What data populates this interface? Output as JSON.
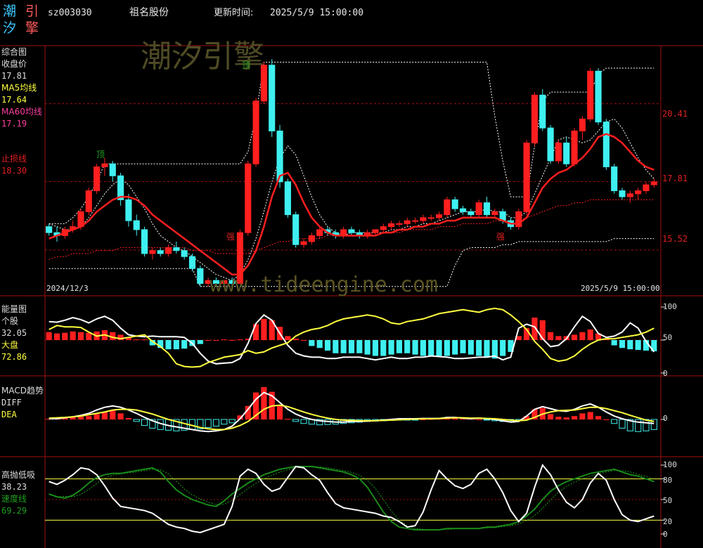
{
  "header": {
    "logo_chars": [
      "潮",
      "引",
      "汐",
      "擎"
    ],
    "code": "sz003030",
    "name": "祖名股份",
    "update_label": "更新时间:",
    "update_time": "2025/5/9 15:00:00"
  },
  "watermark": {
    "main": "潮汐引擎",
    "url": "www.tideengine.com"
  },
  "colors": {
    "up": "#ff1f1f",
    "down": "#3ff0f0",
    "ma5": "#ffff40",
    "ma60": "#ff3fa0",
    "grid": "#a01010",
    "stop": "#e02020",
    "green": "#1a8a1a"
  },
  "panels": {
    "main": {
      "title": "综合图",
      "close_label": "收盘价",
      "close_value": "17.81",
      "ma5_label": "MA5均线",
      "ma5_value": "17.64",
      "ma60_label": "MA60均线",
      "ma60_value": "17.19",
      "stop_label": "止损线",
      "stop_value": "18.30",
      "price_ticks": [
        "20.41",
        "17.81",
        "15.52"
      ],
      "date_start": "2024/12/3",
      "date_end": "2025/5/9  15:00:00",
      "markers": {
        "top1": "顶",
        "top2": "顶",
        "strong1": "强",
        "strong2": "强"
      }
    },
    "energy": {
      "title": "能量图",
      "stock_label": "个股",
      "stock_value": "32.05",
      "market_label": "大盘",
      "market_value": "72.86",
      "ticks": [
        "100",
        "50",
        "0"
      ]
    },
    "macd": {
      "title": "MACD趋势",
      "diff_label": "DIFF",
      "dea_label": "DEA",
      "ticks": [
        "0"
      ]
    },
    "kdj": {
      "title": "高抛低吸",
      "value1": "38.23",
      "speed_label": "速度线",
      "speed_value": "69.29",
      "ticks": [
        "100",
        "80",
        "50",
        "20",
        "0"
      ]
    }
  },
  "chart_data": {
    "type": "candlestick",
    "start_date": "2024/12/3",
    "end_date": "2025/5/9",
    "price_ylim": [
      14.2,
      22.0
    ],
    "price_ticks": [
      20.41,
      17.81,
      15.52
    ],
    "ohlc": [
      [
        16.3,
        16.4,
        16.0,
        16.1
      ],
      [
        16.1,
        16.3,
        15.8,
        16.0
      ],
      [
        16.0,
        16.3,
        15.9,
        16.2
      ],
      [
        16.2,
        16.5,
        16.1,
        16.3
      ],
      [
        16.3,
        16.9,
        16.2,
        16.8
      ],
      [
        16.8,
        17.6,
        16.7,
        17.5
      ],
      [
        17.5,
        18.4,
        17.4,
        18.3
      ],
      [
        18.3,
        18.6,
        18.0,
        18.4
      ],
      [
        18.4,
        18.5,
        17.8,
        18.0
      ],
      [
        18.0,
        18.1,
        17.0,
        17.2
      ],
      [
        17.2,
        17.4,
        16.3,
        16.5
      ],
      [
        16.5,
        16.7,
        16.0,
        16.2
      ],
      [
        16.2,
        16.3,
        15.3,
        15.4
      ],
      [
        15.4,
        15.6,
        15.2,
        15.5
      ],
      [
        15.5,
        15.6,
        15.3,
        15.4
      ],
      [
        15.4,
        15.7,
        15.3,
        15.6
      ],
      [
        15.6,
        15.8,
        15.4,
        15.5
      ],
      [
        15.5,
        15.6,
        15.2,
        15.3
      ],
      [
        15.3,
        15.4,
        14.8,
        14.9
      ],
      [
        14.9,
        15.0,
        14.3,
        14.4
      ],
      [
        14.4,
        14.6,
        14.3,
        14.5
      ],
      [
        14.5,
        14.6,
        14.3,
        14.4
      ],
      [
        14.4,
        14.5,
        14.3,
        14.5
      ],
      [
        14.5,
        14.6,
        14.3,
        14.4
      ],
      [
        14.4,
        16.2,
        14.4,
        16.1
      ],
      [
        16.1,
        18.5,
        16.0,
        18.4
      ],
      [
        18.4,
        20.6,
        18.3,
        20.5
      ],
      [
        20.5,
        21.8,
        20.4,
        21.7
      ],
      [
        21.7,
        21.9,
        19.3,
        19.5
      ],
      [
        19.5,
        19.7,
        17.6,
        17.8
      ],
      [
        17.8,
        17.9,
        16.6,
        16.7
      ],
      [
        16.7,
        16.8,
        15.6,
        15.7
      ],
      [
        15.7,
        15.9,
        15.6,
        15.8
      ],
      [
        15.8,
        16.1,
        15.7,
        16.0
      ],
      [
        16.0,
        16.3,
        15.9,
        16.2
      ],
      [
        16.2,
        16.3,
        16.0,
        16.1
      ],
      [
        16.1,
        16.2,
        15.9,
        16.0
      ],
      [
        16.0,
        16.3,
        15.9,
        16.2
      ],
      [
        16.2,
        16.3,
        16.0,
        16.1
      ],
      [
        16.1,
        16.2,
        15.9,
        16.0
      ],
      [
        16.0,
        16.2,
        15.9,
        16.1
      ],
      [
        16.1,
        16.2,
        16.0,
        16.2
      ],
      [
        16.2,
        16.4,
        16.1,
        16.3
      ],
      [
        16.3,
        16.5,
        16.2,
        16.4
      ],
      [
        16.4,
        16.5,
        16.3,
        16.4
      ],
      [
        16.4,
        16.6,
        16.3,
        16.5
      ],
      [
        16.5,
        16.6,
        16.4,
        16.5
      ],
      [
        16.5,
        16.7,
        16.4,
        16.6
      ],
      [
        16.6,
        16.7,
        16.5,
        16.6
      ],
      [
        16.6,
        16.8,
        16.5,
        16.7
      ],
      [
        16.7,
        17.3,
        16.6,
        17.2
      ],
      [
        17.2,
        17.3,
        16.8,
        16.9
      ],
      [
        16.9,
        17.0,
        16.7,
        16.8
      ],
      [
        16.8,
        16.9,
        16.6,
        16.7
      ],
      [
        16.7,
        17.2,
        16.6,
        17.1
      ],
      [
        17.1,
        17.3,
        16.6,
        16.7
      ],
      [
        16.7,
        16.9,
        16.6,
        16.8
      ],
      [
        16.8,
        16.9,
        16.4,
        16.5
      ],
      [
        16.5,
        16.6,
        16.2,
        16.3
      ],
      [
        16.3,
        16.9,
        16.2,
        16.8
      ],
      [
        16.8,
        19.2,
        16.7,
        19.1
      ],
      [
        19.1,
        20.8,
        19.0,
        20.7
      ],
      [
        20.7,
        20.9,
        19.5,
        19.6
      ],
      [
        19.6,
        19.7,
        18.4,
        18.5
      ],
      [
        18.5,
        19.2,
        18.4,
        19.1
      ],
      [
        19.1,
        19.3,
        18.3,
        18.4
      ],
      [
        18.4,
        19.6,
        18.3,
        19.5
      ],
      [
        19.5,
        20.0,
        19.2,
        19.9
      ],
      [
        19.9,
        21.6,
        19.8,
        21.5
      ],
      [
        21.5,
        21.6,
        19.7,
        19.8
      ],
      [
        19.8,
        19.9,
        18.2,
        18.3
      ],
      [
        18.3,
        18.4,
        17.4,
        17.5
      ],
      [
        17.5,
        17.6,
        17.2,
        17.3
      ],
      [
        17.3,
        17.5,
        17.1,
        17.4
      ],
      [
        17.4,
        17.6,
        17.2,
        17.5
      ],
      [
        17.5,
        17.8,
        17.4,
        17.7
      ],
      [
        17.7,
        17.9,
        17.6,
        17.8
      ]
    ],
    "ma5": [
      16.4,
      16.3,
      16.2,
      16.2,
      16.3,
      16.6,
      17.0,
      17.4,
      17.7,
      17.9,
      17.7,
      17.3,
      16.9,
      16.4,
      16.0,
      15.8,
      15.6,
      15.5,
      15.3,
      15.1,
      14.9,
      14.7,
      14.6,
      14.5,
      14.7,
      15.2,
      15.9,
      16.8,
      17.8,
      18.6,
      19.0,
      18.7,
      18.0,
      17.3,
      16.7,
      16.3,
      16.1,
      16.0,
      16.1,
      16.1,
      16.1,
      16.1,
      16.1,
      16.2,
      16.2,
      16.3,
      16.3,
      16.4,
      16.4,
      16.5,
      16.6,
      16.7,
      16.8,
      16.8,
      16.8,
      16.9,
      16.8,
      16.8,
      16.6,
      16.6,
      16.8,
      17.4,
      18.0,
      18.6,
      19.2,
      19.3,
      19.2,
      19.1,
      19.2,
      19.5,
      19.8,
      19.9,
      19.6,
      19.1,
      18.6,
      18.2,
      17.9
    ],
    "ma60": [
      15.2,
      15.3,
      15.3,
      15.4,
      15.4,
      15.4,
      15.5,
      15.5,
      15.5,
      15.6,
      15.6,
      15.6,
      15.6,
      15.6,
      15.6,
      15.6,
      15.6,
      15.6,
      15.5,
      15.5,
      15.5,
      15.4,
      15.4,
      15.4,
      15.4,
      15.4,
      15.5,
      15.6,
      15.7,
      15.8,
      15.8,
      15.9,
      15.9,
      15.9,
      15.9,
      16.0,
      16.0,
      16.0,
      16.0,
      16.0,
      16.0,
      16.1,
      16.1,
      16.1,
      16.1,
      16.2,
      16.2,
      16.2,
      16.2,
      16.3,
      16.3,
      16.3,
      16.4,
      16.4,
      16.4,
      16.4,
      16.5,
      16.5,
      16.5,
      16.5,
      16.6,
      16.7,
      16.8,
      16.9,
      17.0,
      17.0,
      17.1,
      17.1,
      17.2,
      17.2,
      17.2,
      17.2,
      17.2,
      17.2,
      17.2,
      17.2,
      17.2
    ],
    "ema": [
      15.9,
      16.0,
      16.1,
      16.2,
      16.3,
      16.5,
      16.8,
      17.0,
      17.2,
      17.3,
      17.3,
      17.2,
      17.0,
      16.7,
      16.5,
      16.3,
      16.1,
      15.9,
      15.7,
      15.5,
      15.3,
      15.1,
      14.9,
      14.7,
      14.7,
      15.0,
      15.5,
      16.3,
      17.3,
      18.0,
      18.1,
      17.7,
      17.1,
      16.6,
      16.3,
      16.1,
      16.0,
      16.0,
      16.0,
      16.0,
      16.0,
      16.0,
      16.1,
      16.1,
      16.2,
      16.2,
      16.3,
      16.3,
      16.4,
      16.4,
      16.5,
      16.5,
      16.6,
      16.6,
      16.6,
      16.6,
      16.6,
      16.5,
      16.4,
      16.4,
      16.6,
      17.1,
      17.6,
      17.9,
      18.1,
      18.2,
      18.4,
      18.6,
      18.9,
      19.3,
      19.4,
      19.3,
      19.1,
      18.8,
      18.5,
      18.3,
      18.2
    ],
    "upper_band": [
      16.4,
      16.4,
      16.4,
      16.6,
      16.9,
      17.3,
      17.8,
      18.4,
      18.4,
      18.4,
      18.4,
      18.4,
      18.4,
      18.4,
      18.4,
      18.4,
      18.4,
      18.4,
      18.4,
      18.4,
      18.4,
      18.4,
      18.4,
      18.4,
      18.4,
      18.8,
      20.0,
      21.8,
      21.8,
      21.8,
      21.8,
      21.8,
      21.8,
      21.8,
      21.8,
      21.8,
      21.8,
      21.8,
      21.8,
      21.8,
      21.8,
      21.8,
      21.8,
      21.8,
      21.8,
      21.8,
      21.8,
      21.8,
      21.8,
      21.8,
      21.8,
      21.8,
      21.8,
      21.8,
      21.8,
      21.8,
      20.0,
      18.5,
      17.3,
      17.3,
      17.3,
      19.0,
      20.5,
      20.8,
      20.8,
      20.8,
      20.8,
      20.8,
      20.8,
      21.4,
      21.6,
      21.6,
      21.6,
      21.6,
      21.6,
      21.6,
      21.6
    ],
    "lower_band": [
      14.9,
      14.9,
      14.9,
      14.9,
      14.9,
      14.9,
      14.9,
      14.9,
      14.9,
      14.9,
      14.9,
      14.9,
      14.9,
      14.9,
      14.9,
      14.9,
      14.9,
      14.9,
      14.9,
      14.3,
      14.3,
      14.3,
      14.3,
      14.3,
      14.3,
      14.3,
      14.3,
      14.3,
      14.3,
      14.3,
      14.3,
      14.3,
      14.3,
      14.3,
      14.3,
      14.3,
      14.3,
      14.3,
      14.3,
      14.3,
      14.3,
      14.3,
      14.3,
      14.3,
      14.3,
      14.3,
      14.3,
      14.3,
      14.3,
      14.3,
      14.3,
      15.0,
      15.5,
      15.6,
      15.6,
      15.6,
      15.6,
      15.7,
      15.7,
      15.8,
      15.8,
      15.8,
      15.8,
      15.8,
      15.8,
      15.8,
      15.8,
      15.8,
      15.8,
      15.8,
      15.8,
      15.9,
      15.9,
      15.9,
      15.9,
      15.9,
      15.9
    ],
    "energy_stock": [
      78,
      77,
      80,
      84,
      81,
      76,
      82,
      86,
      80,
      68,
      58,
      56,
      55,
      56,
      55,
      55,
      55,
      54,
      45,
      30,
      18,
      14,
      15,
      16,
      22,
      45,
      75,
      88,
      80,
      60,
      42,
      30,
      26,
      24,
      24,
      22,
      22,
      24,
      24,
      24,
      22,
      20,
      22,
      24,
      22,
      22,
      24,
      24,
      26,
      25,
      24,
      22,
      22,
      23,
      24,
      24,
      26,
      20,
      24,
      68,
      74,
      70,
      52,
      40,
      42,
      52,
      70,
      86,
      78,
      60,
      54,
      56,
      62,
      76,
      68,
      48,
      32
    ],
    "energy_market": [
      66,
      72,
      70,
      70,
      69,
      62,
      56,
      58,
      54,
      52,
      54,
      56,
      58,
      48,
      40,
      30,
      14,
      10,
      9,
      10,
      16,
      20,
      24,
      26,
      28,
      34,
      30,
      32,
      38,
      42,
      46,
      56,
      62,
      66,
      68,
      72,
      78,
      82,
      84,
      86,
      88,
      86,
      82,
      76,
      74,
      78,
      80,
      82,
      86,
      90,
      92,
      94,
      96,
      94,
      92,
      96,
      98,
      96,
      88,
      78,
      66,
      48,
      36,
      22,
      18,
      20,
      26,
      36,
      44,
      50,
      52,
      52,
      54,
      56,
      58,
      62,
      68
    ],
    "energy_bars": [
      12,
      10,
      11,
      13,
      12,
      11,
      13,
      15,
      12,
      8,
      4,
      1,
      1,
      -8,
      -12,
      -14,
      -14,
      -13,
      -9,
      -6,
      0,
      0,
      1,
      0,
      1,
      2,
      24,
      32,
      30,
      20,
      6,
      2,
      0,
      -9,
      -12,
      -16,
      -20,
      -20,
      -20,
      -20,
      -22,
      -24,
      -24,
      -22,
      -20,
      -20,
      -22,
      -24,
      -24,
      -24,
      -24,
      -22,
      -20,
      -22,
      -24,
      -26,
      -28,
      -24,
      -18,
      6,
      18,
      34,
      30,
      12,
      6,
      6,
      8,
      12,
      16,
      10,
      2,
      -8,
      -12,
      -14,
      -15,
      -16,
      -17
    ],
    "macd_diff": [
      0.02,
      0.02,
      0.05,
      0.08,
      0.12,
      0.18,
      0.28,
      0.36,
      0.4,
      0.36,
      0.28,
      0.18,
      0.06,
      -0.04,
      -0.12,
      -0.18,
      -0.22,
      -0.26,
      -0.3,
      -0.34,
      -0.36,
      -0.34,
      -0.3,
      -0.2,
      0.02,
      0.3,
      0.6,
      0.8,
      0.7,
      0.5,
      0.3,
      0.16,
      0.06,
      0.0,
      -0.04,
      -0.06,
      -0.08,
      -0.08,
      -0.06,
      -0.06,
      -0.05,
      -0.04,
      -0.02,
      0.0,
      0.02,
      0.02,
      0.02,
      0.03,
      0.03,
      0.03,
      0.06,
      0.06,
      0.04,
      0.02,
      0.04,
      0.02,
      0.0,
      -0.04,
      -0.08,
      -0.06,
      0.1,
      0.3,
      0.38,
      0.32,
      0.26,
      0.24,
      0.3,
      0.4,
      0.46,
      0.36,
      0.22,
      0.1,
      0.02,
      -0.04,
      -0.08,
      -0.1,
      -0.12
    ],
    "macd_dea": [
      0.04,
      0.05,
      0.06,
      0.08,
      0.1,
      0.14,
      0.18,
      0.22,
      0.28,
      0.3,
      0.3,
      0.28,
      0.22,
      0.16,
      0.08,
      0.0,
      -0.06,
      -0.12,
      -0.18,
      -0.24,
      -0.28,
      -0.3,
      -0.3,
      -0.26,
      -0.18,
      -0.06,
      0.12,
      0.3,
      0.4,
      0.42,
      0.38,
      0.3,
      0.22,
      0.15,
      0.09,
      0.04,
      0.0,
      -0.02,
      -0.03,
      -0.04,
      -0.04,
      -0.04,
      -0.03,
      -0.02,
      -0.01,
      0.0,
      0.01,
      0.02,
      0.02,
      0.03,
      0.04,
      0.05,
      0.05,
      0.04,
      0.04,
      0.03,
      0.02,
      0.0,
      -0.02,
      -0.04,
      -0.02,
      0.06,
      0.16,
      0.22,
      0.26,
      0.27,
      0.28,
      0.32,
      0.36,
      0.36,
      0.32,
      0.26,
      0.2,
      0.12,
      0.05,
      -0.02,
      -0.06
    ],
    "macd_bars": [
      0.02,
      0.03,
      0.04,
      0.06,
      0.08,
      0.1,
      0.16,
      0.22,
      0.26,
      0.18,
      0.04,
      -0.06,
      -0.18,
      -0.26,
      -0.3,
      -0.32,
      -0.34,
      -0.32,
      -0.3,
      -0.28,
      -0.24,
      -0.2,
      -0.14,
      -0.1,
      0.12,
      0.4,
      0.8,
      0.96,
      0.82,
      0.4,
      0.02,
      -0.06,
      -0.12,
      -0.14,
      -0.16,
      -0.15,
      -0.14,
      -0.12,
      -0.1,
      -0.08,
      -0.06,
      -0.05,
      -0.04,
      -0.03,
      -0.02,
      -0.02,
      -0.01,
      0.0,
      0.01,
      0.02,
      0.03,
      0.04,
      0.04,
      0.02,
      0.0,
      -0.02,
      -0.04,
      -0.06,
      -0.06,
      -0.04,
      0.1,
      0.3,
      0.34,
      0.16,
      0.08,
      0.06,
      0.1,
      0.18,
      0.22,
      0.1,
      0.0,
      -0.12,
      -0.26,
      -0.34,
      -0.36,
      -0.34,
      -0.3
    ],
    "kdj_fast": [
      76,
      72,
      78,
      86,
      96,
      94,
      86,
      70,
      52,
      40,
      38,
      36,
      34,
      30,
      22,
      14,
      10,
      8,
      4,
      2,
      6,
      10,
      14,
      40,
      84,
      94,
      88,
      72,
      62,
      66,
      82,
      98,
      96,
      86,
      78,
      60,
      44,
      38,
      36,
      34,
      32,
      30,
      26,
      24,
      18,
      10,
      12,
      32,
      64,
      92,
      80,
      70,
      66,
      72,
      88,
      94,
      80,
      60,
      34,
      18,
      30,
      68,
      100,
      86,
      64,
      46,
      38,
      50,
      74,
      88,
      78,
      50,
      28,
      20,
      18,
      22,
      26
    ],
    "kdj_speed": [
      58,
      54,
      52,
      56,
      64,
      74,
      82,
      86,
      88,
      88,
      90,
      92,
      94,
      96,
      90,
      76,
      64,
      56,
      50,
      46,
      42,
      40,
      48,
      58,
      66,
      74,
      80,
      86,
      90,
      94,
      96,
      98,
      98,
      98,
      96,
      94,
      92,
      90,
      86,
      80,
      68,
      50,
      32,
      18,
      10,
      8,
      6,
      6,
      6,
      6,
      8,
      8,
      8,
      8,
      8,
      10,
      10,
      12,
      14,
      18,
      26,
      36,
      50,
      62,
      70,
      76,
      80,
      84,
      88,
      90,
      92,
      94,
      90,
      86,
      84,
      80,
      76
    ],
    "kdj_ticks": [
      100,
      80,
      50,
      20,
      0
    ]
  }
}
